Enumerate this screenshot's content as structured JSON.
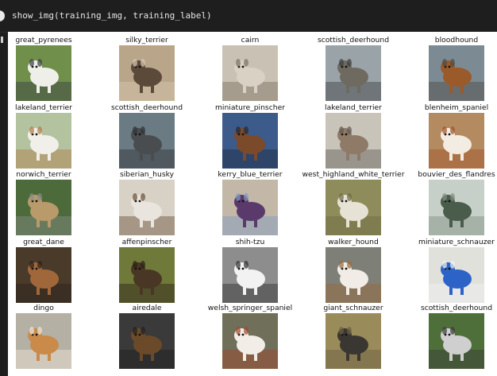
{
  "cell": {
    "code": "show_img(training_img, training_label)"
  },
  "grid": {
    "rows": [
      [
        {
          "label": "great_pyrenees",
          "bg": "#6f8f4a",
          "subject": "#efefea",
          "accent": "#3a3f45"
        },
        {
          "label": "silky_terrier",
          "bg": "#b9a58a",
          "subject": "#5b4a3a",
          "accent": "#d8c9b0"
        },
        {
          "label": "cairn",
          "bg": "#c9c2b4",
          "subject": "#d8d1c4",
          "accent": "#7b6f60"
        },
        {
          "label": "scottish_deerhound",
          "bg": "#9aa3a8",
          "subject": "#6e6a60",
          "accent": "#3b3d3e"
        },
        {
          "label": "bloodhound",
          "bg": "#7c8a93",
          "subject": "#9a5a2a",
          "accent": "#4d4a44"
        }
      ],
      [
        {
          "label": "lakeland_terrier",
          "bg": "#b3c3a0",
          "subject": "#f1efe9",
          "accent": "#b27a48"
        },
        {
          "label": "scottish_deerhound",
          "bg": "#6a7b84",
          "subject": "#4a4d50",
          "accent": "#2e3134"
        },
        {
          "label": "miniature_pinscher",
          "bg": "#3c5a8a",
          "subject": "#7a4a2a",
          "accent": "#1d2a40"
        },
        {
          "label": "lakeland_terrier",
          "bg": "#c9c4ba",
          "subject": "#8e7a66",
          "accent": "#5f5a54"
        },
        {
          "label": "blenheim_spaniel",
          "bg": "#b48a60",
          "subject": "#f3ece2",
          "accent": "#a0512a"
        }
      ],
      [
        {
          "label": "norwich_terrier",
          "bg": "#4d6a3a",
          "subject": "#b99a6a",
          "accent": "#8a8f8c"
        },
        {
          "label": "siberian_husky",
          "bg": "#d7d1c6",
          "subject": "#e9e5de",
          "accent": "#6a4e35"
        },
        {
          "label": "kerry_blue_terrier",
          "bg": "#c3b7a7",
          "subject": "#5a3a6a",
          "accent": "#7e9bc4"
        },
        {
          "label": "west_highland_white_terrier",
          "bg": "#8e8c5a",
          "subject": "#e6e2d6",
          "accent": "#6d6a44"
        },
        {
          "label": "bouvier_des_flandres",
          "bg": "#c7cfc9",
          "subject": "#4a5c4c",
          "accent": "#7f8f80"
        }
      ],
      [
        {
          "label": "great_dane",
          "bg": "#4a3a2a",
          "subject": "#a0683a",
          "accent": "#2b2118"
        },
        {
          "label": "affenpinscher",
          "bg": "#6f7a3a",
          "subject": "#4a3624",
          "accent": "#2a2018"
        },
        {
          "label": "shih-tzu",
          "bg": "#8d8d8d",
          "subject": "#f2f2f2",
          "accent": "#2e2e2e"
        },
        {
          "label": "walker_hound",
          "bg": "#7e7f76",
          "subject": "#f1ede6",
          "accent": "#9a6a3a"
        },
        {
          "label": "miniature_schnauzer",
          "bg": "#e1e1dc",
          "subject": "#2d63c7",
          "accent": "#f2f2f2"
        }
      ],
      [
        {
          "label": "dingo",
          "bg": "#b5b0a4",
          "subject": "#c98a4a",
          "accent": "#f0e6d8"
        },
        {
          "label": "airedale",
          "bg": "#3a3a3a",
          "subject": "#6b4a2a",
          "accent": "#1f1f1f"
        },
        {
          "label": "welsh_springer_spaniel",
          "bg": "#6f6f5a",
          "subject": "#f2eee7",
          "accent": "#a1472a"
        },
        {
          "label": "giant_schnauzer",
          "bg": "#9a8b5a",
          "subject": "#3a3632",
          "accent": "#6a5f44"
        },
        {
          "label": "scottish_deerhound",
          "bg": "#4f6f3a",
          "subject": "#cfcfcf",
          "accent": "#3a3a3a"
        }
      ]
    ]
  }
}
